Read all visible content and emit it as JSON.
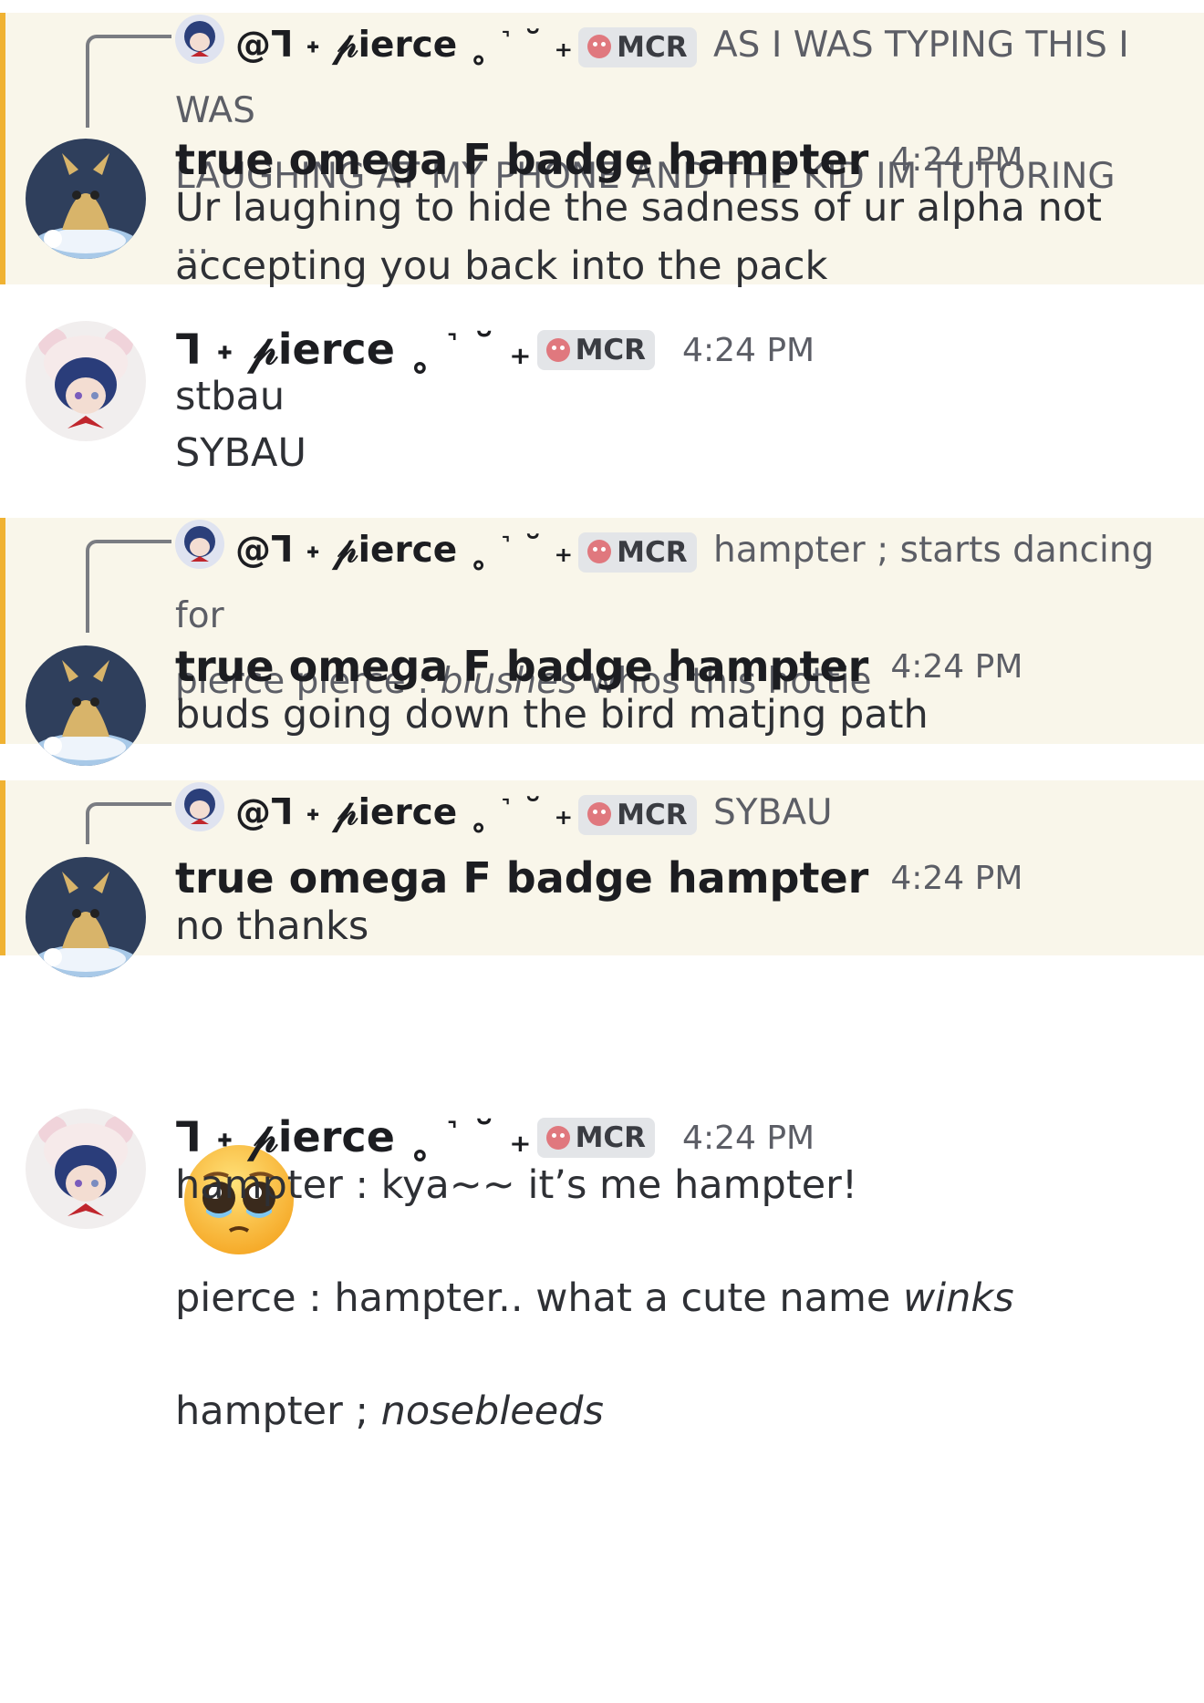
{
  "badge_label": "MCR",
  "colors": {
    "highlight_bg": "#f9f6ea",
    "highlight_bar": "#f0b232",
    "badge_bg": "#e3e5e8",
    "timestamp": "#5c5e66"
  },
  "messages": [
    {
      "reply": {
        "name": "@ᒣ ˖ 𝓅ierce ˳ ˺ ˘ ₊",
        "text_1": " AS I WAS TYPING THIS I WAS",
        "text_2": "LAUGHING AT MY PHONE AND THE KID IM TUTORING ..."
      },
      "author": "true omega F badge hampter",
      "time": "4:24 PM",
      "text_1": "Ur laughing to hide the sadness of ur alpha not",
      "text_2": "accepting you back into the pack"
    },
    {
      "author": "ᒣ ˖ 𝓅ierce ˳ ˺ ˘ ₊",
      "time": "4:24 PM",
      "text_1": "stbau",
      "text_2": "SYBAU"
    },
    {
      "reply": {
        "name": "@ᒣ ˖ 𝓅ierce ˳ ˺ ˘ ₊",
        "text_1": " hampter ; starts dancing for",
        "text_2_pre": "pierce  pierce : ",
        "text_2_em": "blushes",
        "text_2_post": " whos this hottie"
      },
      "author": "true omega F badge hampter",
      "time": "4:24 PM",
      "text_1": "buds going down the bird matjng path"
    },
    {
      "reply": {
        "name": "@ᒣ ˖ 𝓅ierce ˳ ˺ ˘ ₊",
        "text_1": " SYBAU"
      },
      "author": "true omega F badge hampter",
      "time": "4:24 PM",
      "text_1": "no thanks",
      "emoji": "pleading-face"
    },
    {
      "author": "ᒣ ˖ 𝓅ierce ˳ ˺ ˘ ₊",
      "time": "4:24 PM",
      "line_1": "hampter : kya~~ it’s me hampter!",
      "line_2_pre": "pierce : hampter.. what a cute name ",
      "line_2_em": "winks",
      "line_3_pre": "hampter ; ",
      "line_3_em": "nosebleeds"
    }
  ]
}
